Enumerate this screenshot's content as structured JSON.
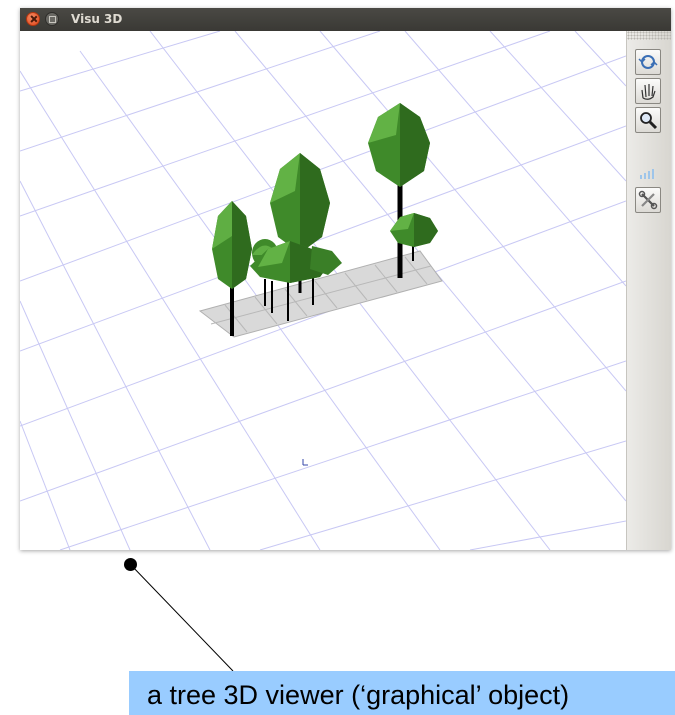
{
  "window": {
    "title": "Visu 3D",
    "buttons": [
      "close-icon",
      "maximize-icon"
    ]
  },
  "toolbar": {
    "tools": [
      {
        "name": "rotate-tool",
        "icon": "rotate-icon"
      },
      {
        "name": "pan-tool",
        "icon": "hand-icon"
      },
      {
        "name": "zoom-tool",
        "icon": "magnifier-icon"
      },
      {
        "name": "settings-tool",
        "icon": "tools-icon"
      }
    ]
  },
  "scene": {
    "grid_color": "#c8c8f4",
    "plot_color": "#d9d9d9",
    "foliage_color": "#3f8a2a",
    "trunk_color": "#000000",
    "origin_marker": "axis-icon"
  },
  "annotation": {
    "label": "a tree 3D viewer (‘graphical’ object)",
    "background": "#99ccff"
  }
}
